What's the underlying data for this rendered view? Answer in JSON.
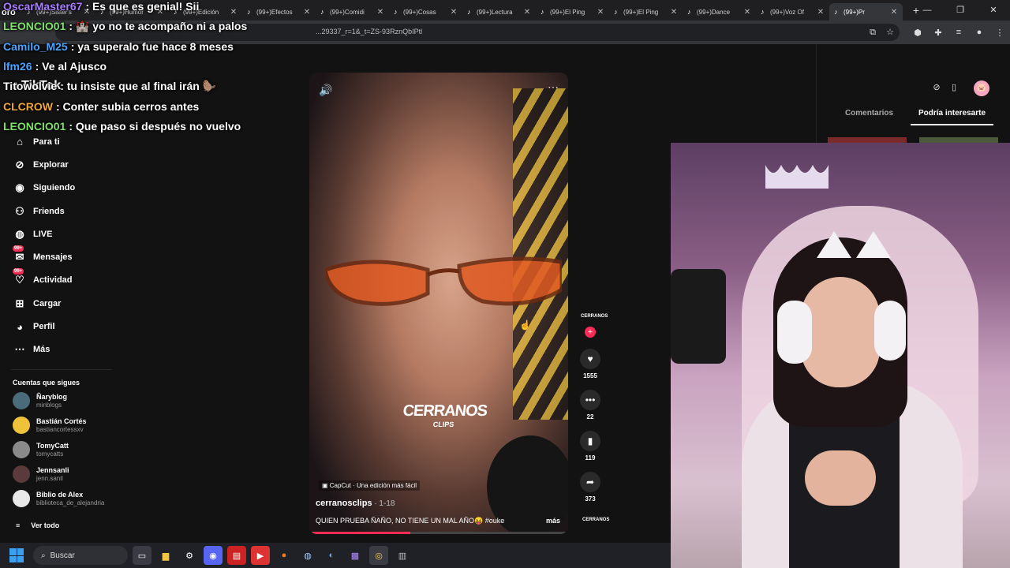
{
  "tabs": [
    {
      "label": "(99+)Sister's"
    },
    {
      "label": "(99+)Humor"
    },
    {
      "label": "(99+)Edición"
    },
    {
      "label": "(99+)Efectos"
    },
    {
      "label": "(99+)Comidi"
    },
    {
      "label": "(99+)Cosas"
    },
    {
      "label": "(99+)Lectura"
    },
    {
      "label": "(99+)El Ping"
    },
    {
      "label": "(99+)El Ping"
    },
    {
      "label": "(99+)Dance"
    },
    {
      "label": "(99+)Voz Of"
    },
    {
      "label": "(99+)Pr"
    }
  ],
  "address": {
    "url": "...29337_r=1&_t=ZS-93RznQbIPtl"
  },
  "chat": {
    "top": "oro",
    "lines": [
      {
        "user": "OscarMaster67",
        "color": "#a97cff",
        "text": ": Es que es genial! Sii"
      },
      {
        "user": "LEONCIO01",
        "color": "#7ee06a",
        "text": ": 🏰 yo no te acompaño ni a palos"
      },
      {
        "user": "Camilo_M25",
        "color": "#4aa3ff",
        "text": ": ya superalo fue hace 8 meses"
      },
      {
        "user": "lfm26",
        "color": "#4aa3ff",
        "text": ": Ve al Ajusco"
      },
      {
        "user": "Titowolvie",
        "color": "#ffffff",
        "text": ": tu insiste que al final irán 🦫"
      },
      {
        "user": "CLCROW",
        "color": "#f1a63a",
        "text": ": Conter subia cerros antes"
      },
      {
        "user": "LEONCIO01",
        "color": "#7ee06a",
        "text": ": Que paso si después no vuelvo"
      }
    ]
  },
  "sidebar": {
    "logo": "TikTok",
    "items": [
      {
        "label": "Para ti",
        "icon": "home-icon"
      },
      {
        "label": "Explorar",
        "icon": "compass-icon"
      },
      {
        "label": "Siguiendo",
        "icon": "following-icon"
      },
      {
        "label": "Friends",
        "icon": "friends-icon"
      },
      {
        "label": "LIVE",
        "icon": "live-icon"
      },
      {
        "label": "Mensajes",
        "icon": "messages-icon",
        "badge": "99+"
      },
      {
        "label": "Actividad",
        "icon": "activity-icon",
        "badge": "99+"
      },
      {
        "label": "Cargar",
        "icon": "upload-icon"
      },
      {
        "label": "Perfil",
        "icon": "profile-icon"
      },
      {
        "label": "Más",
        "icon": "more-icon"
      }
    ],
    "following_title": "Cuentas que sigues",
    "accounts": [
      {
        "name": "Ñaryblog",
        "handle": "minblogs"
      },
      {
        "name": "Bastián Cortés",
        "handle": "bastiancortessxv"
      },
      {
        "name": "TomyCatt",
        "handle": "tomycatts"
      },
      {
        "name": "Jennsanli",
        "handle": "jenn.sanil"
      },
      {
        "name": "Biblio de Alex",
        "handle": "biblioteca_de_alejandria"
      }
    ],
    "see_all": "Ver todo"
  },
  "video": {
    "watermark": "CERRANOS",
    "watermark_sub": "CLIPS",
    "capcut": "CapCut · Una edición más fácil",
    "author": "cerranosclips",
    "date": " · 1-18",
    "description": "QUIEN PRUEBA ÑAÑO, NO TIENE UN MAL AÑO😝 #ouke",
    "more": "más",
    "progress": 0.39
  },
  "actions": {
    "avatar_text": "CERRANOS",
    "likes": "1555",
    "comments": "22",
    "saves": "119",
    "shares": "373"
  },
  "right_panel": {
    "tabs": [
      "Comentarios",
      "Podría interesarte"
    ],
    "active_tab": 1
  },
  "taskbar": {
    "search": "Buscar"
  }
}
